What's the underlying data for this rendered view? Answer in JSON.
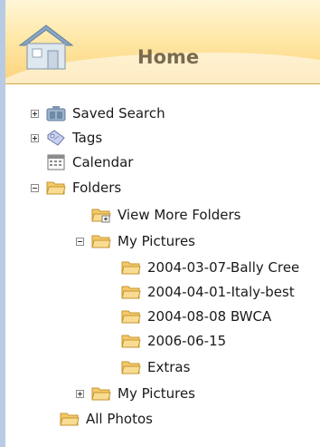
{
  "header": {
    "title": "Home",
    "icon": "home-icon"
  },
  "colors": {
    "header_top": "#fff6d8",
    "header_bottom": "#fbd37a",
    "panel_border": "#b9cbe2",
    "folder": "#f6d27a"
  },
  "tree": {
    "saved_search": {
      "label": "Saved Search",
      "icon": "binoculars-icon",
      "expanded": false
    },
    "tags": {
      "label": "Tags",
      "icon": "tag-icon",
      "expanded": false
    },
    "calendar": {
      "label": "Calendar",
      "icon": "calendar-icon"
    },
    "folders": {
      "label": "Folders",
      "icon": "folder-icon",
      "expanded": true
    },
    "view_more_folders": {
      "label": "View More Folders",
      "icon": "folder-add-icon"
    },
    "my_pictures_1": {
      "label": "My Pictures",
      "icon": "folder-icon",
      "expanded": true
    },
    "sub_folders": [
      {
        "label": "2004-03-07-Bally Cree"
      },
      {
        "label": "2004-04-01-Italy-best"
      },
      {
        "label": "2004-08-08 BWCA"
      },
      {
        "label": "2006-06-15"
      },
      {
        "label": "Extras"
      }
    ],
    "my_pictures_2": {
      "label": "My Pictures",
      "icon": "folder-icon",
      "expanded": false
    },
    "all_photos": {
      "label": "All Photos",
      "icon": "folder-icon"
    }
  }
}
